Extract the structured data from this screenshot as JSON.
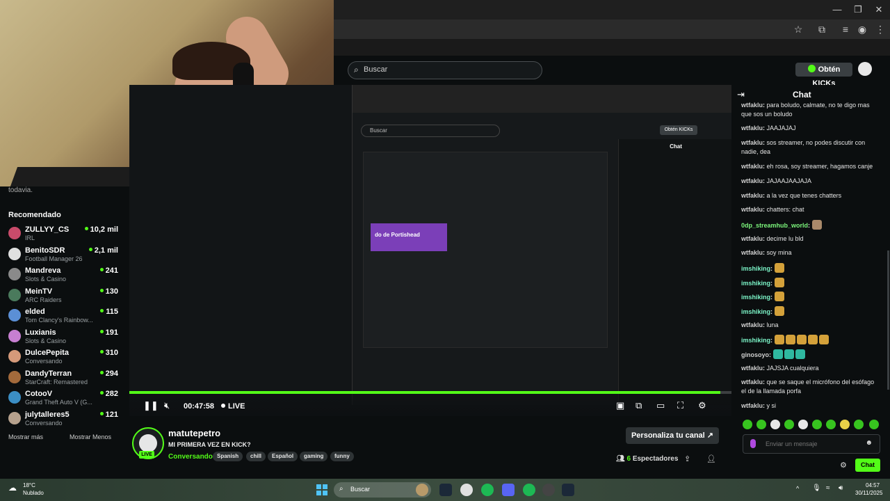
{
  "browser": {
    "window_controls": [
      "—",
      "❐",
      "✕"
    ],
    "toolbar_icons": [
      "star-icon",
      "extensions-icon",
      "queue-icon",
      "profile-icon",
      "menu-icon"
    ]
  },
  "header": {
    "search_placeholder": "Buscar",
    "kicks_button": "Obtén KICKs"
  },
  "sidebar": {
    "top_text": "todavia.",
    "recommended_title": "Recomendado",
    "channels": [
      {
        "name": "ZULLYY_CS",
        "category": "IRL",
        "viewers": "10,2 mil",
        "color": "#c94b6a"
      },
      {
        "name": "BenitoSDR",
        "category": "Football Manager 26",
        "viewers": "2,1 mil",
        "color": "#e0e0e0"
      },
      {
        "name": "Mandreva",
        "category": "Slots & Casino",
        "viewers": "241",
        "color": "#8a8a8a"
      },
      {
        "name": "MeinTV",
        "category": "ARC Raiders",
        "viewers": "130",
        "color": "#4a7a5c"
      },
      {
        "name": "elded",
        "category": "Tom Clancy's Rainbow...",
        "viewers": "115",
        "color": "#5b8fd6"
      },
      {
        "name": "Luxianis",
        "category": "Slots & Casino",
        "viewers": "191",
        "color": "#c77fd1"
      },
      {
        "name": "DulcePepita",
        "category": "Conversando",
        "viewers": "310",
        "color": "#d59a7a"
      },
      {
        "name": "DandyTerran",
        "category": "StarCraft: Remastered",
        "viewers": "294",
        "color": "#a36a3b"
      },
      {
        "name": "CotooV",
        "category": "Grand Theft Auto V (G...",
        "viewers": "282",
        "color": "#3b8ec4"
      },
      {
        "name": "julytalleres5",
        "category": "Conversando",
        "viewers": "121",
        "color": "#b6a18d"
      }
    ],
    "show_more": "Mostrar más",
    "show_less": "Mostrar Menos"
  },
  "video": {
    "time": "00:47:58",
    "live_label": "LIVE",
    "nested_kicks": "Obtén KICKs",
    "nested_search": "Buscar",
    "nested_chat_title": "Chat",
    "nested_banner": "do de Portishead"
  },
  "stream": {
    "streamer": "matutepetro",
    "title": "MI PRIMERA VEZ EN KICK?",
    "category": "Conversando",
    "tags": [
      "Spanish",
      "chill",
      "Español",
      "gaming",
      "funny"
    ],
    "live_badge": "LIVE",
    "customize_label": "Personaliza tu canal",
    "viewers_count": "6",
    "viewers_label": "Espectadores"
  },
  "chat": {
    "title": "Chat",
    "messages": [
      {
        "user": "wtfaklu",
        "text": "para boludo, calmate, no te digo mas que sos un boludo",
        "color": "#ffffff"
      },
      {
        "user": "wtfaklu",
        "text": "JAAJAJAJ",
        "color": "#ffffff"
      },
      {
        "user": "wtfaklu",
        "text": "sos streamer, no podes discutir con nadie, dea",
        "color": "#ffffff"
      },
      {
        "user": "wtfaklu",
        "text": "eh rosa, soy streamer, hagamos canje",
        "color": "#ffffff"
      },
      {
        "user": "wtfaklu",
        "text": "JAJAAJAAJAJA",
        "color": "#ffffff"
      },
      {
        "user": "wtfaklu",
        "text": "a la vez que tenes chatters",
        "color": "#ffffff"
      },
      {
        "user": "wtfaklu",
        "text": "chatters: chat",
        "color": "#ffffff"
      },
      {
        "user": "0dp_streamhub_world",
        "text": "",
        "color": "#7cf57c",
        "emotes": 1,
        "emote_color": "#a9896a"
      },
      {
        "user": "wtfaklu",
        "text": "decime lu bld",
        "color": "#ffffff"
      },
      {
        "user": "wtfaklu",
        "text": "soy mina",
        "color": "#ffffff"
      },
      {
        "user": "imshiking",
        "text": "",
        "color": "#7cf5c8",
        "emotes": 1,
        "emote_color": "#d4a13a"
      },
      {
        "user": "imshiking",
        "text": "",
        "color": "#7cf5c8",
        "emotes": 1,
        "emote_color": "#d4a13a"
      },
      {
        "user": "imshiking",
        "text": "",
        "color": "#7cf5c8",
        "emotes": 1,
        "emote_color": "#d4a13a"
      },
      {
        "user": "imshiking",
        "text": "",
        "color": "#7cf5c8",
        "emotes": 1,
        "emote_color": "#d4a13a"
      },
      {
        "user": "wtfaklu",
        "text": "luna",
        "color": "#ffffff"
      },
      {
        "user": "imshiking",
        "text": "",
        "color": "#7cf5c8",
        "emotes": 5,
        "emote_color": "#d4a13a"
      },
      {
        "user": "ginosoyo",
        "text": "",
        "color": "#ffffff",
        "emotes": 3,
        "emote_color": "#2fb8a0"
      },
      {
        "user": "wtfaklu",
        "text": "JAJSJA cualquiera",
        "color": "#ffffff"
      },
      {
        "user": "wtfaklu",
        "text": "que se saque el micrófono del esófago el de la llamada porfa",
        "color": "#ffffff"
      },
      {
        "user": "wtfaklu",
        "text": "y si",
        "color": "#ffffff"
      }
    ],
    "input_placeholder": "Enviar un mensaje",
    "send_label": "Chat"
  },
  "taskbar": {
    "temp": "18°C",
    "weather": "Nublado",
    "search": "Buscar",
    "time": "04:57",
    "date": "30/11/2025"
  }
}
